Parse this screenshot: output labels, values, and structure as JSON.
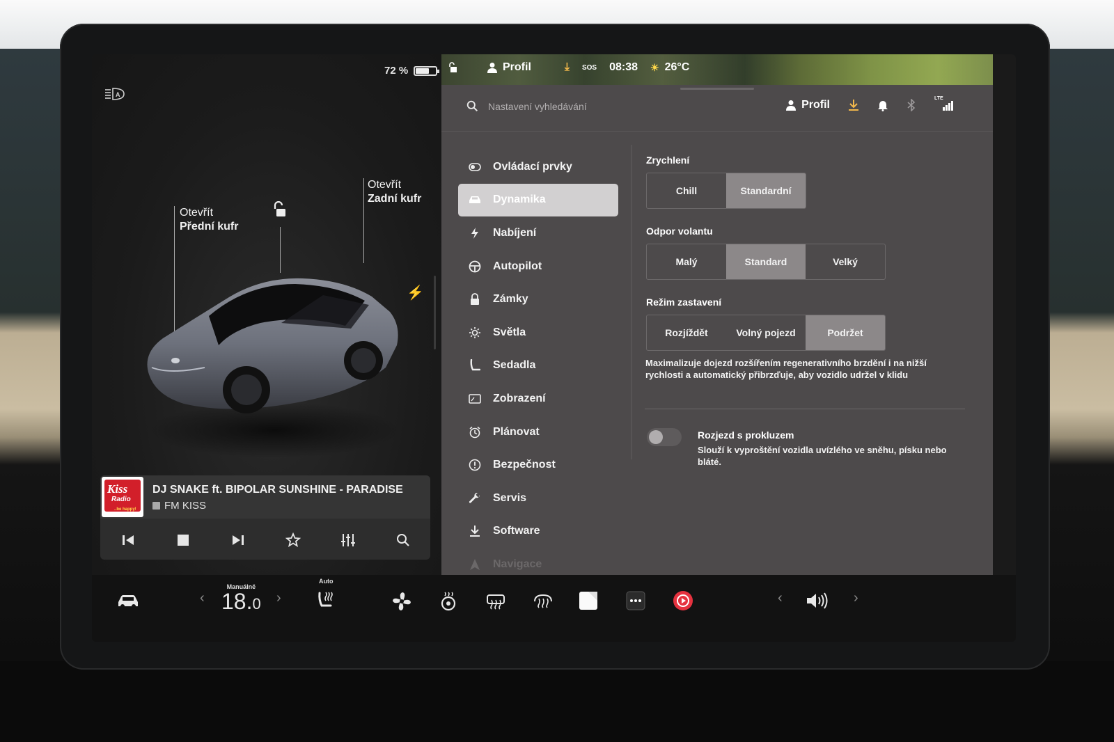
{
  "status": {
    "battery": "72 %",
    "battery_fraction": 0.72,
    "profile": "Profil",
    "sos": "SOS",
    "time": "08:38",
    "temperature": "26°C"
  },
  "car": {
    "front_trunk": {
      "line1": "Otevřít",
      "line2": "Přední kufr"
    },
    "rear_trunk": {
      "line1": "Otevřít",
      "line2": "Zadní kufr"
    }
  },
  "media": {
    "logo_text": "Kiss",
    "logo_sub": "Radio",
    "logo_tagline": "..be happy!",
    "song": "DJ SNAKE ft. BIPOLAR SUNSHINE - PARADISE",
    "station": "FM KISS",
    "controls": [
      "previous-icon",
      "stop-icon",
      "next-icon",
      "favorite-icon",
      "equalizer-icon",
      "search-icon"
    ]
  },
  "header": {
    "search_placeholder": "Nastavení vyhledávání",
    "profile_label": "Profil",
    "lte_label": "LTE"
  },
  "menu": {
    "items": [
      {
        "label": "Ovládací prvky",
        "icon": "toggle-icon"
      },
      {
        "label": "Dynamika",
        "icon": "car-icon",
        "active": true
      },
      {
        "label": "Nabíjení",
        "icon": "bolt-icon"
      },
      {
        "label": "Autopilot",
        "icon": "steering-wheel-icon"
      },
      {
        "label": "Zámky",
        "icon": "lock-icon"
      },
      {
        "label": "Světla",
        "icon": "sun-icon"
      },
      {
        "label": "Sedadla",
        "icon": "seat-icon"
      },
      {
        "label": "Zobrazení",
        "icon": "display-icon"
      },
      {
        "label": "Plánovat",
        "icon": "alarm-clock-icon"
      },
      {
        "label": "Bezpečnost",
        "icon": "info-circle-icon"
      },
      {
        "label": "Servis",
        "icon": "wrench-icon"
      },
      {
        "label": "Software",
        "icon": "download-icon"
      },
      {
        "label": "Navigace",
        "icon": "navigation-icon"
      }
    ]
  },
  "settings": {
    "acceleration": {
      "title": "Zrychlení",
      "options": [
        "Chill",
        "Standardní"
      ],
      "selected": "Standardní"
    },
    "steering": {
      "title": "Odpor volantu",
      "options": [
        "Malý",
        "Standard",
        "Velký"
      ],
      "selected": "Standard"
    },
    "stopping": {
      "title": "Režim zastavení",
      "options": [
        "Rozjíždět",
        "Volný pojezd",
        "Podržet"
      ],
      "selected": "Podržet",
      "description": "Maximalizuje dojezd rozšířením regenerativního brzdění i na nižší rychlosti a automatický přibrzďuje, aby vozidlo udržel v klidu"
    },
    "slip_start": {
      "title": "Rozjezd s prokluzem",
      "description": "Slouží k vyproštění vozidla uvízlého ve sněhu, písku nebo bláté.",
      "enabled": false
    }
  },
  "bottom_bar": {
    "temp_mode": "Manuálně",
    "temp_whole": "18.",
    "temp_decimal": "0",
    "seat_heat_mode": "Auto",
    "accent_record": "#e5323f"
  }
}
